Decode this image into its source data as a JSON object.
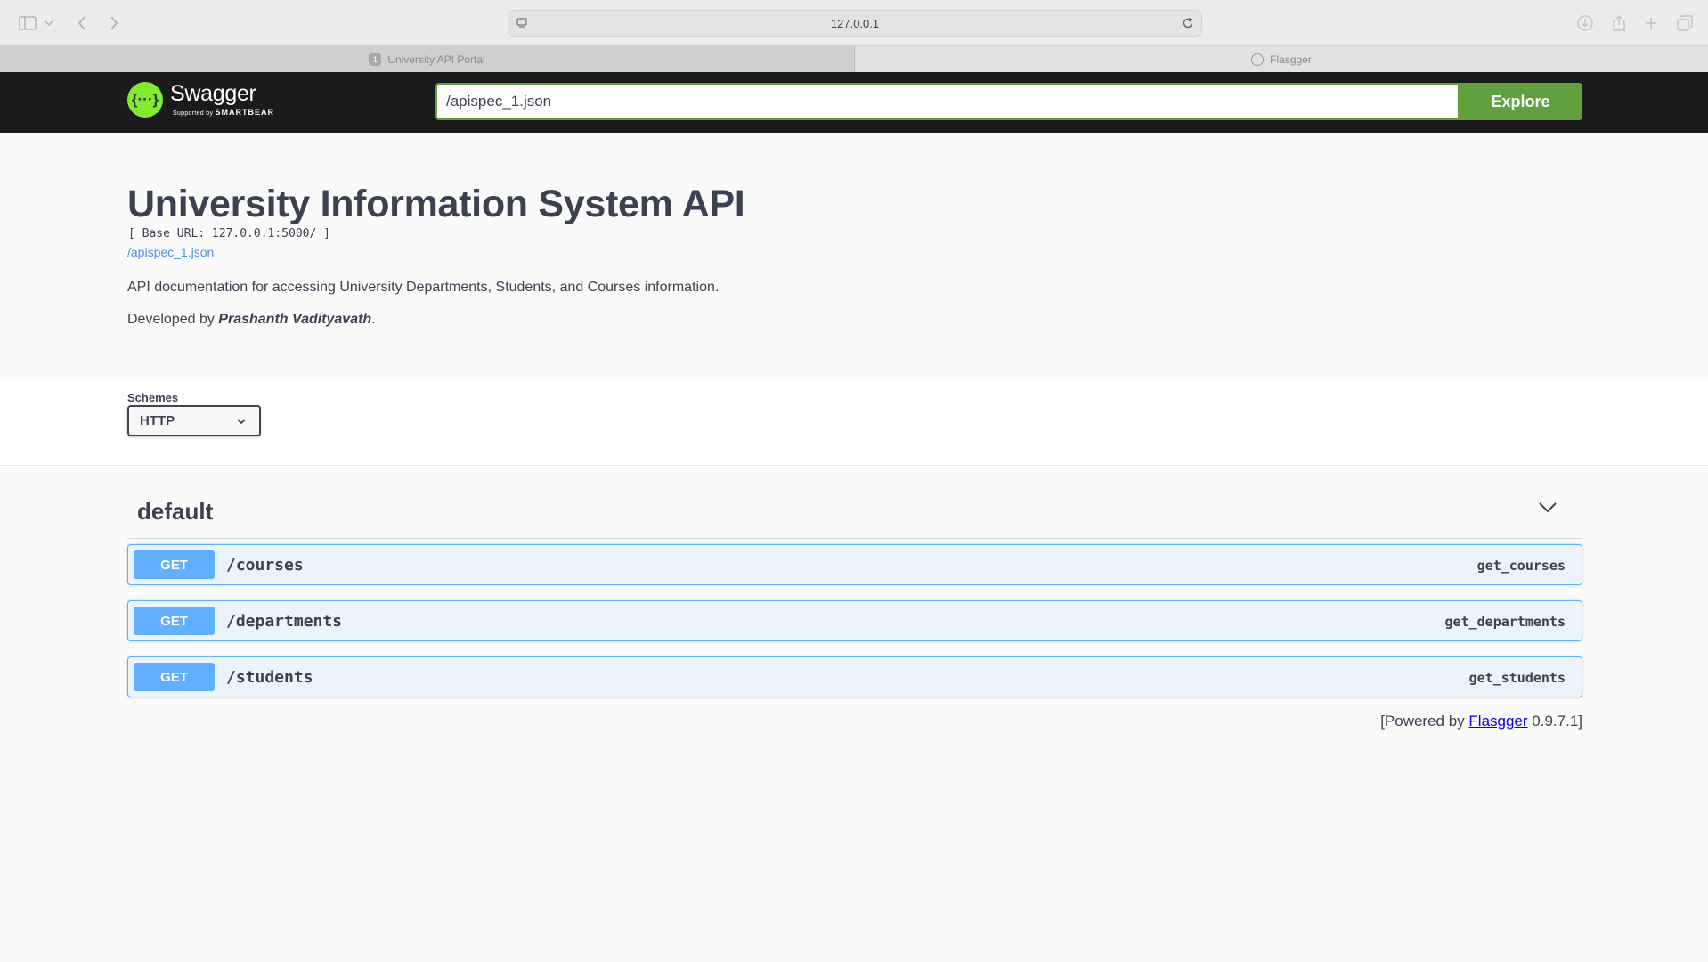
{
  "browser": {
    "address": "127.0.0.1",
    "tabs": [
      {
        "label": "University API Portal",
        "favicon": "1"
      },
      {
        "label": "Flasgger"
      }
    ]
  },
  "topbar": {
    "logo_name": "Swagger",
    "logo_supported": "Supported by",
    "logo_brand": "SMARTBEAR",
    "url_value": "/apispec_1.json",
    "explore_label": "Explore"
  },
  "info": {
    "title": "University Information System API",
    "base_url": "[ Base URL: 127.0.0.1:5000/ ]",
    "spec_link": "/apispec_1.json",
    "description": "API documentation for accessing University Departments, Students, and Courses information.",
    "developed_prefix": "Developed by ",
    "developer": "Prashanth Vadityavath",
    "developed_suffix": "."
  },
  "schemes": {
    "label": "Schemes",
    "selected": "HTTP"
  },
  "section": {
    "title": "default",
    "operations": [
      {
        "method": "GET",
        "path": "/courses",
        "operation_id": "get_courses"
      },
      {
        "method": "GET",
        "path": "/departments",
        "operation_id": "get_departments"
      },
      {
        "method": "GET",
        "path": "/students",
        "operation_id": "get_students"
      }
    ]
  },
  "footer": {
    "prefix": "[Powered by ",
    "link": "Flasgger",
    "suffix": " 0.9.7.1]"
  },
  "colors": {
    "topbar_bg": "#1b1b1b",
    "accent_green": "#62a03f",
    "get_blue": "#61affe",
    "get_bg": "#ebf3fb",
    "text": "#3b4151"
  }
}
